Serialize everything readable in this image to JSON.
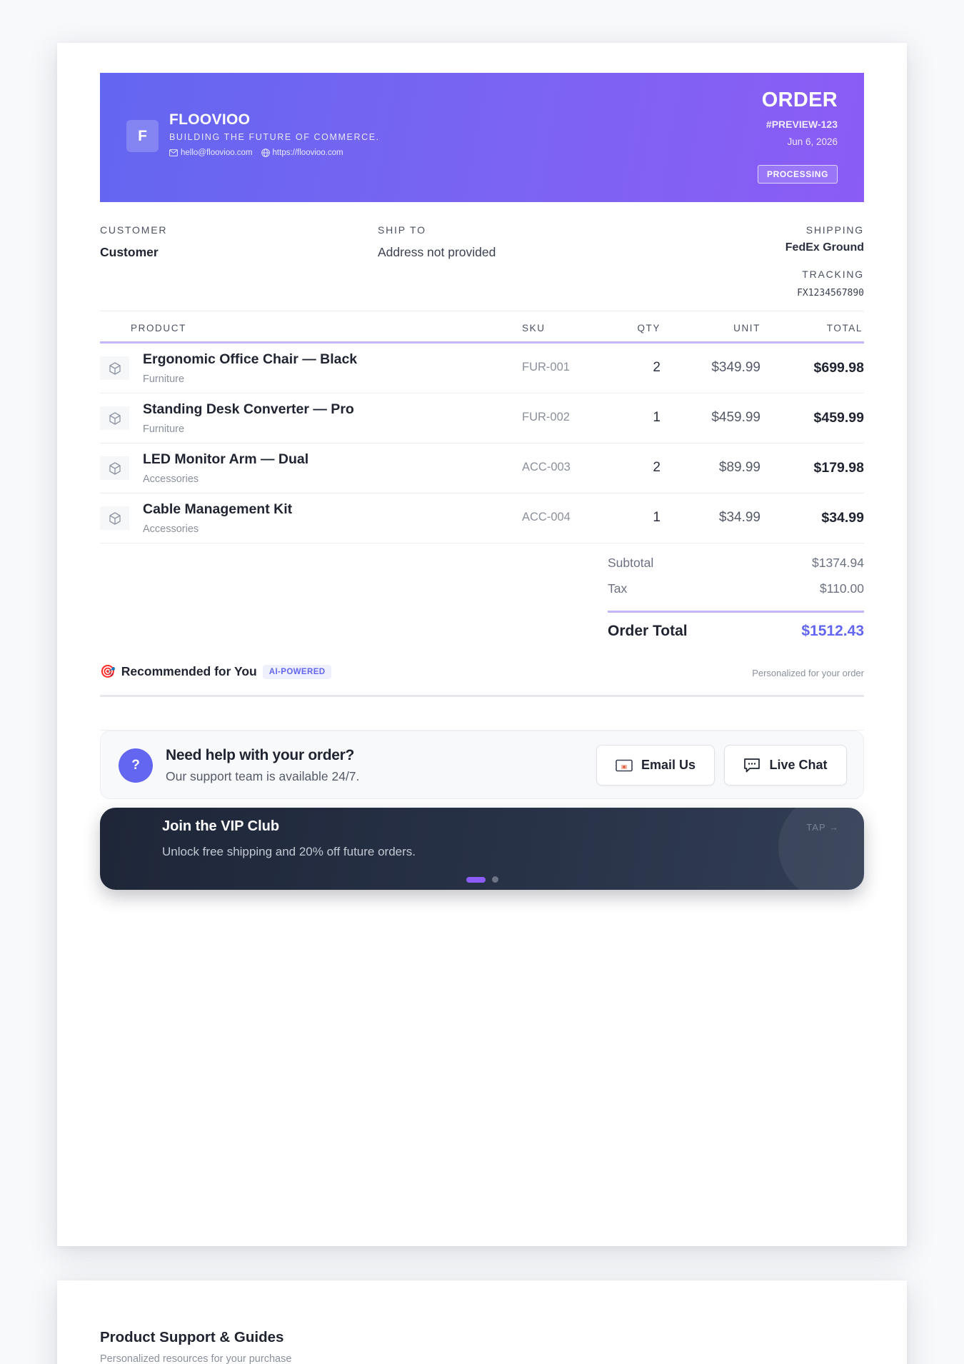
{
  "header": {
    "logo_letter": "F",
    "brand_name": "FLOOVIOO",
    "tagline": "BUILDING THE FUTURE OF COMMERCE.",
    "email": "hello@floovioo.com",
    "website": "https://floovioo.com",
    "doc_title": "ORDER",
    "order_number": "#PREVIEW-123",
    "order_date": "Jun 6, 2026",
    "status": "PROCESSING"
  },
  "info": {
    "customer_label": "CUSTOMER",
    "customer_value": "Customer",
    "shipto_label": "SHIP TO",
    "shipto_value": "Address not provided",
    "shipping_label": "SHIPPING",
    "shipping_value": "FedEx Ground",
    "tracking_label": "TRACKING",
    "tracking_value": "FX1234567890"
  },
  "table": {
    "headers": {
      "product": "PRODUCT",
      "sku": "SKU",
      "qty": "QTY",
      "unit": "UNIT",
      "total": "TOTAL"
    },
    "rows": [
      {
        "name": "Ergonomic Office Chair — Black",
        "category": "Furniture",
        "sku": "FUR-001",
        "qty": "2",
        "unit": "$349.99",
        "total": "$699.98"
      },
      {
        "name": "Standing Desk Converter — Pro",
        "category": "Furniture",
        "sku": "FUR-002",
        "qty": "1",
        "unit": "$459.99",
        "total": "$459.99"
      },
      {
        "name": "LED Monitor Arm — Dual",
        "category": "Accessories",
        "sku": "ACC-003",
        "qty": "2",
        "unit": "$89.99",
        "total": "$179.98"
      },
      {
        "name": "Cable Management Kit",
        "category": "Accessories",
        "sku": "ACC-004",
        "qty": "1",
        "unit": "$34.99",
        "total": "$34.99"
      }
    ]
  },
  "totals": {
    "subtotal_label": "Subtotal",
    "subtotal_value": "$1374.94",
    "tax_label": "Tax",
    "tax_value": "$110.00",
    "grand_label": "Order Total",
    "grand_value": "$1512.43"
  },
  "recommended": {
    "emoji": "🎯",
    "title": "Recommended for You",
    "badge": "AI-POWERED",
    "subtitle": "Personalized for your order"
  },
  "support": {
    "icon_text": "?",
    "title": "Need help with your order?",
    "subtitle": "Our support team is available 24/7.",
    "email_button": "Email Us",
    "chat_button": "Live Chat"
  },
  "vip": {
    "title": "Join the VIP Club",
    "subtitle": "Unlock free shipping and 20% off future orders.",
    "tap": "TAP →"
  },
  "page2": {
    "title": "Product Support & Guides",
    "subtitle": "Personalized resources for your purchase"
  },
  "colors": {
    "accent": "#6366f1",
    "accent_purple": "#8b5cf6",
    "rule": "#c4b5fd",
    "dark_banner": "#1e2638"
  }
}
